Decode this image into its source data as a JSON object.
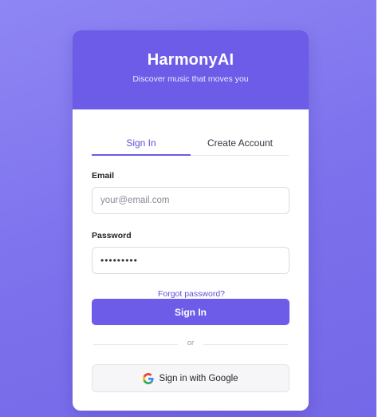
{
  "header": {
    "app_title": "HarmonyAI",
    "subtitle": "Discover music that moves you"
  },
  "tabs": [
    {
      "label": "Sign In",
      "active": true
    },
    {
      "label": "Create Account",
      "active": false
    }
  ],
  "form": {
    "email_label": "Email",
    "email_placeholder": "your@email.com",
    "email_value": "",
    "password_label": "Password",
    "password_value": "•••••••••",
    "forgot_password": "Forgot password?",
    "submit_label": "Sign In",
    "divider_text": "or",
    "google_label": "Sign in with Google",
    "google_icon": "google-g-icon"
  },
  "colors": {
    "accent": "#6c5ce7",
    "background_start": "#8f86f4",
    "background_end": "#7568e8",
    "link": "#5e4fd6"
  }
}
